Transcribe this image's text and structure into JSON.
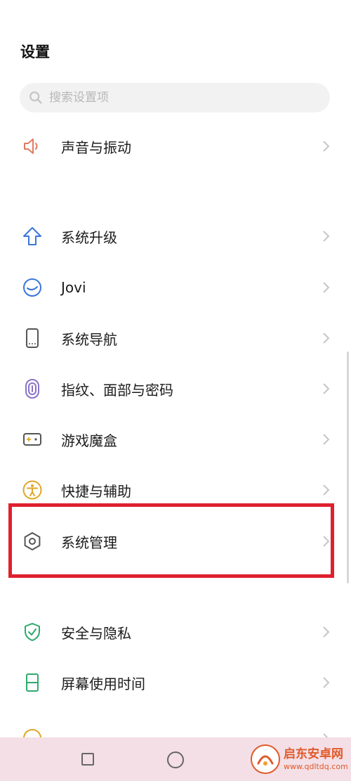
{
  "header": {
    "title": "设置"
  },
  "search": {
    "placeholder": "搜索设置项",
    "icon": "search-icon"
  },
  "menu": [
    {
      "id": "sound",
      "label": "声音与振动",
      "icon": "speaker-icon",
      "icon_color": "#e07a60"
    },
    {
      "id": "system-update",
      "label": "系统升级",
      "icon": "upgrade-arrow-icon",
      "icon_color": "#3a76d8"
    },
    {
      "id": "jovi",
      "label": "Jovi",
      "icon": "jovi-icon",
      "icon_color": "#3a76d8"
    },
    {
      "id": "navigation",
      "label": "系统导航",
      "icon": "phone-icon",
      "icon_color": "#555555"
    },
    {
      "id": "security-password",
      "label": "指纹、面部与密码",
      "icon": "fingerprint-icon",
      "icon_color": "#8a72c8"
    },
    {
      "id": "game-box",
      "label": "游戏魔盒",
      "icon": "gamepad-icon",
      "icon_color": "#555555"
    },
    {
      "id": "accessibility",
      "label": "快捷与辅助",
      "icon": "accessibility-icon",
      "icon_color": "#e0a626"
    },
    {
      "id": "system-management",
      "label": "系统管理",
      "icon": "hexagon-gear-icon",
      "icon_color": "#555555",
      "highlighted": true
    },
    {
      "id": "privacy",
      "label": "安全与隐私",
      "icon": "shield-check-icon",
      "icon_color": "#2faa6a"
    },
    {
      "id": "screen-time",
      "label": "屏幕使用时间",
      "icon": "hourglass-icon",
      "icon_color": "#2faa6a"
    }
  ],
  "colors": {
    "highlight": "#e0202e",
    "nav_bar": "#f4dfe6",
    "watermark": "#e05a2a"
  },
  "navbar": {
    "buttons": [
      "recent-apps-button",
      "home-button"
    ]
  },
  "watermark": {
    "title": "启东安卓网",
    "url": "www.qdltdq.com"
  }
}
